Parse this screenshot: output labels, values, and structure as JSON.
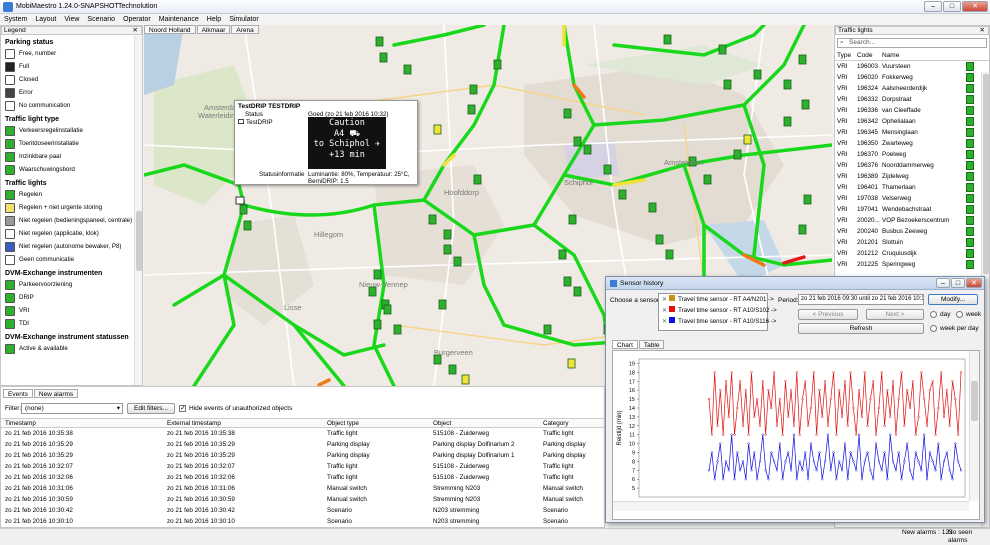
{
  "window": {
    "title": "MobiMaestro 1.24.0-SNAPSHOT",
    "company": "Technolution"
  },
  "menu": [
    "System",
    "Layout",
    "View",
    "Scenario",
    "Operator",
    "Maintenance",
    "Help",
    "Simulator"
  ],
  "legend": {
    "header": "Legend",
    "sections": [
      {
        "title": "Parking status",
        "items": [
          {
            "label": "Free, number",
            "color": "#ffffff"
          },
          {
            "label": "Full",
            "color": "#222222"
          },
          {
            "label": "Closed",
            "color": "#ffffff"
          },
          {
            "label": "Error",
            "color": "#444444"
          },
          {
            "label": "No communication",
            "color": "#ffffff"
          }
        ]
      },
      {
        "title": "Traffic light type",
        "items": [
          {
            "label": "Verkeersregelinstallatie",
            "color": "#2eaf2e"
          },
          {
            "label": "Toeritdoseerinstallatie",
            "color": "#2eaf2e"
          },
          {
            "label": "Inzinkbare paal",
            "color": "#2eaf2e"
          },
          {
            "label": "Waarschuwingsbord",
            "color": "#2eaf2e"
          }
        ]
      },
      {
        "title": "Traffic lights",
        "items": [
          {
            "label": "Regelen",
            "color": "#2eaf2e"
          },
          {
            "label": "Regelen + niet urgente storing",
            "color": "#f2e26b"
          },
          {
            "label": "Niet regelen (bedieningspaneel, centrale)",
            "color": "#9a9a9a"
          },
          {
            "label": "Niet regelen (applicatie, klok)",
            "color": "#ffffff"
          },
          {
            "label": "Niet regelen (autonome bewaker, P8)",
            "color": "#3a5fbf"
          },
          {
            "label": "Geen communicatie",
            "color": "#ffffff"
          }
        ]
      },
      {
        "title": "DVM-Exchange instrumenten",
        "items": [
          {
            "label": "Parkeervoorziening",
            "color": "#2eaf2e"
          },
          {
            "label": "DRIP",
            "color": "#2eaf2e"
          },
          {
            "label": "VRI",
            "color": "#2eaf2e"
          },
          {
            "label": "TDI",
            "color": "#2eaf2e"
          }
        ]
      },
      {
        "title": "DVM-Exchange instrument statussen",
        "items": [
          {
            "label": "Active & available",
            "color": "#2eaf2e"
          }
        ]
      }
    ]
  },
  "map": {
    "tabs": [
      "Noord Holland",
      "Alkmaar",
      "Arena"
    ],
    "places": [
      {
        "name": "Amsterdam",
        "x": 60,
        "y": 85
      },
      {
        "name": "Waterleidingduinen",
        "x": 54,
        "y": 93
      },
      {
        "name": "Hillegom",
        "x": 170,
        "y": 212
      },
      {
        "name": "Lisse",
        "x": 140,
        "y": 285
      },
      {
        "name": "Nieuw-Vennep",
        "x": 215,
        "y": 262
      },
      {
        "name": "Hoofddorp",
        "x": 300,
        "y": 170
      },
      {
        "name": "Schiphol",
        "x": 420,
        "y": 160
      },
      {
        "name": "Amstelveen",
        "x": 520,
        "y": 140
      },
      {
        "name": "Burgerveen",
        "x": 290,
        "y": 330
      }
    ]
  },
  "popup": {
    "title": "TestDRIP TESTDRIP",
    "status_label": "Status",
    "status_value": "Goed (zo 21 feb 2016 10:32)",
    "device": "TestDRIP",
    "drip_lines": [
      "Caution",
      "A4 ⛟",
      "to Schiphol ✈",
      "+13 min"
    ],
    "info_label": "Statusinformatie",
    "info_value1": "Luminantie: 80%, Temperatuur: 25°C,",
    "info_value2": "BerniDRIP: 1.5"
  },
  "traffic_lights": {
    "header": "Traffic lights",
    "search_placeholder": "Search...",
    "columns": [
      "Type",
      "Code",
      "Name"
    ],
    "rows": [
      [
        "VRI",
        "196003",
        "Vuursteen"
      ],
      [
        "VRI",
        "196020",
        "Fokkerweg"
      ],
      [
        "VRI",
        "196324",
        "Aalsmeerderdijk"
      ],
      [
        "VRI",
        "196332",
        "Dorpstraat"
      ],
      [
        "VRI",
        "196336",
        "van Cleeffade"
      ],
      [
        "VRI",
        "196342",
        "Ophelialaan"
      ],
      [
        "VRI",
        "196345",
        "Mensinglaan"
      ],
      [
        "VRI",
        "196350",
        "Zwarteweg"
      ],
      [
        "VRI",
        "196370",
        "Poelweg"
      ],
      [
        "VRI",
        "196376",
        "Noorddammerweg"
      ],
      [
        "VRI",
        "196389",
        "Zijdelweg"
      ],
      [
        "VRI",
        "196401",
        "Thamerlaan"
      ],
      [
        "VRI",
        "197038",
        "Velserweg"
      ],
      [
        "VRI",
        "197041",
        "Wendebachstraat"
      ],
      [
        "VRI",
        "20020...",
        "VOP Bezoekerscentrum"
      ],
      [
        "VRI",
        "200240",
        "Busbus Zeeweg"
      ],
      [
        "VRI",
        "201201",
        "Slottuin"
      ],
      [
        "VRI",
        "201212",
        "Cruquiusdijk"
      ],
      [
        "VRI",
        "201225",
        "Speringweg"
      ]
    ]
  },
  "events": {
    "tabs": [
      "Events",
      "New alarms"
    ],
    "filter_label": "Filter:",
    "filter_value": "(none)",
    "edit_filters": "Edit filters...",
    "hide_label": "Hide events of unauthorized objects",
    "columns": [
      "Timestamp",
      "External timestamp",
      "Object type",
      "Object",
      "Category"
    ],
    "rows": [
      [
        "zo 21 feb 2016 10:35:38",
        "zo 21 feb 2016 10:35:38",
        "Traffic light",
        "515108 - Zuiderweg",
        "Traffic light"
      ],
      [
        "zo 21 feb 2016 10:35:29",
        "zo 21 feb 2016 10:35:29",
        "Parking display",
        "Parking display Dolfinarium 2",
        "Parking display"
      ],
      [
        "zo 21 feb 2016 10:35:29",
        "zo 21 feb 2016 10:35:29",
        "Parking display",
        "Parking display Dolfinarium 1",
        "Parking display"
      ],
      [
        "zo 21 feb 2016 10:32:07",
        "zo 21 feb 2016 10:32:07",
        "Traffic light",
        "515108 - Zuiderweg",
        "Traffic light"
      ],
      [
        "zo 21 feb 2016 10:32:06",
        "zo 21 feb 2016 10:32:06",
        "Traffic light",
        "515108 - Zuiderweg",
        "Traffic light"
      ],
      [
        "zo 21 feb 2016 10:31:06",
        "zo 21 feb 2016 10:31:06",
        "Manual switch",
        "Stremming N203",
        "Manual switch"
      ],
      [
        "zo 21 feb 2016 10:30:59",
        "zo 21 feb 2016 10:30:59",
        "Manual switch",
        "Stremming N203",
        "Manual switch"
      ],
      [
        "zo 21 feb 2016 10:30:42",
        "zo 21 feb 2016 10:30:42",
        "Scenario",
        "N203 stremming",
        "Scenario"
      ],
      [
        "zo 21 feb 2016 10:30:10",
        "zo 21 feb 2016 10:30:10",
        "Scenario",
        "N203 stremming",
        "Scenario"
      ]
    ]
  },
  "status": {
    "new_alarms": "New alarms : 123",
    "no_seen": "No seen alarms"
  },
  "sensor": {
    "title": "Sensor history",
    "choose_label": "Choose a sensor:",
    "sensors": [
      {
        "label": "Travel time sensor - RT A4/N201 ->",
        "color": "#c8901e"
      },
      {
        "label": "Travel time sensor - RT A10/S102 ->",
        "color": "#e01010"
      },
      {
        "label": "Travel time sensor - RT A10/S116 ->",
        "color": "#1010e0"
      }
    ],
    "period_label": "Period:",
    "period_value": "zo 21 feb 2016 09:30 until zo 21 feb 2016 10:36",
    "modify": "Modify...",
    "previous": "< Previous",
    "next": "Next >",
    "refresh": "Refresh",
    "day": "day",
    "week": "week",
    "week_per_day": "week per day",
    "tabs": [
      "Chart",
      "Table"
    ]
  },
  "chart_data": {
    "type": "line",
    "ylabel": "Reistijd (min)",
    "ylim": [
      4,
      19.5
    ],
    "yticks": [
      5,
      6,
      7,
      8,
      9,
      10,
      11,
      12,
      13,
      14,
      15,
      16,
      17,
      18,
      19
    ],
    "series": [
      {
        "name": "Travel time sensor - RT A10/S102 ->",
        "color": "#e01010",
        "values": [
          15,
          11,
          18,
          12,
          16,
          11,
          17,
          13,
          18,
          11,
          14,
          17,
          12,
          16,
          11,
          18,
          13,
          15,
          12,
          17,
          11,
          16,
          14,
          18,
          12,
          15,
          11,
          17,
          13,
          16,
          12,
          18,
          11,
          15,
          17,
          12,
          14,
          18,
          11,
          16,
          13,
          17,
          12,
          15,
          18,
          11,
          16,
          13,
          17,
          12,
          18,
          14,
          11,
          16,
          13,
          18,
          12,
          15,
          17,
          11,
          14,
          18,
          12,
          16,
          13,
          17,
          11,
          15,
          18,
          12,
          16,
          14,
          17,
          11,
          13,
          18,
          15,
          12,
          16,
          17,
          11,
          14,
          18,
          13,
          16,
          12,
          17,
          15,
          11,
          18
        ]
      },
      {
        "name": "Travel time sensor - RT A10/S116 ->",
        "color": "#1010e0",
        "values": [
          7,
          9,
          6,
          8,
          10,
          6,
          8,
          7,
          11,
          6,
          9,
          7,
          8,
          6,
          10,
          7,
          9,
          6,
          8,
          11,
          7,
          6,
          9,
          8,
          7,
          10,
          6,
          8,
          9,
          7,
          11,
          6,
          8,
          7,
          9,
          6,
          10,
          8,
          7,
          9,
          6,
          8,
          11,
          7,
          9,
          6,
          8,
          7,
          10,
          6,
          9,
          8,
          7,
          11,
          6,
          8,
          9,
          7,
          6,
          10,
          8,
          7,
          9,
          6,
          11,
          8,
          7,
          9,
          6,
          8,
          10,
          7,
          6,
          9,
          8,
          7,
          11,
          6,
          9,
          8,
          7,
          10,
          6,
          8,
          9,
          7,
          6,
          10,
          8,
          7
        ]
      }
    ]
  }
}
